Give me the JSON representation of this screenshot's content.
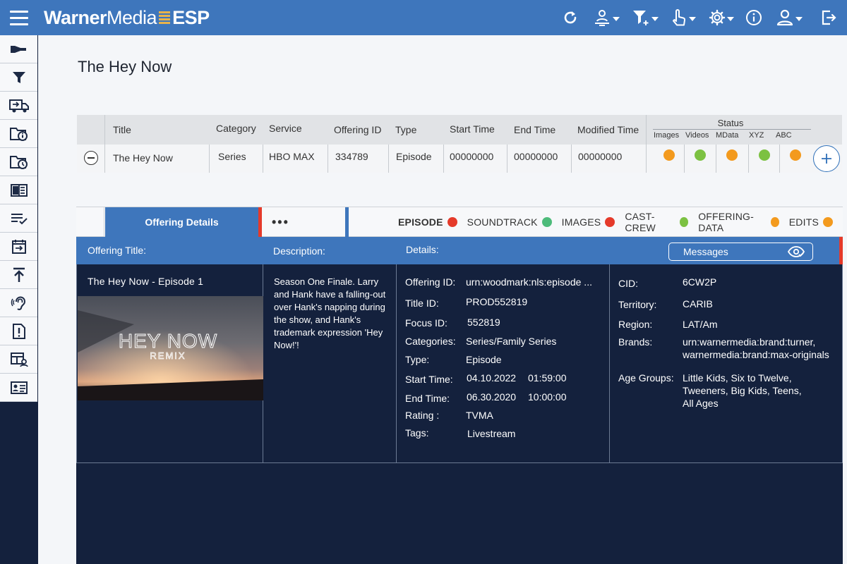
{
  "app": {
    "brand_part1": "Warner",
    "brand_part2": "Media",
    "brand_part3": "ESP"
  },
  "topbar_icons": [
    "refresh-icon",
    "user-location-icon",
    "filter-add-icon",
    "touch-icon",
    "gear-icon",
    "info-icon",
    "user-icon",
    "exit-icon"
  ],
  "sidebar_icons": [
    "hand-offer-icon",
    "filter-icon",
    "delivery-truck-icon",
    "folder-info-icon",
    "folder-clock-icon",
    "book-icon",
    "checklist-icon",
    "calendar-arrow-icon",
    "upload-icon",
    "ear-icon",
    "alert-doc-icon",
    "grid-user-icon",
    "id-card-icon"
  ],
  "page": {
    "title": "The Hey Now"
  },
  "table": {
    "headers": {
      "title": "Title",
      "category": "Category",
      "service": "Service",
      "offering_id": "Offering ID",
      "type": "Type",
      "start_time": "Start Time",
      "end_time": "End Time",
      "modified_time": "Modified Time",
      "status": "Status"
    },
    "status_columns": [
      "Images",
      "Videos",
      "MData",
      "XYZ",
      "ABC"
    ],
    "row": {
      "title": "The Hey Now",
      "category": "Series",
      "service": "HBO MAX",
      "offering_id": "334789",
      "type": "Episode",
      "start_time": "00000000",
      "end_time": "00000000",
      "modified_time": "00000000",
      "status_colors": [
        "#f39a1e",
        "#7cc142",
        "#f39a1e",
        "#7cc142",
        "#f39a1e"
      ]
    }
  },
  "tabs": {
    "active": "Offering Details",
    "more": "•••",
    "sections": [
      {
        "label": "EPISODE",
        "color": "#e53a2a",
        "active": true
      },
      {
        "label": "SOUNDTRACK",
        "color": "#4dbb7a"
      },
      {
        "label": "IMAGES",
        "color": "#e53a2a"
      },
      {
        "label": "CAST-CREW",
        "color": "#7cc142"
      },
      {
        "label": "OFFERING-DATA",
        "color": "#f39a1e"
      },
      {
        "label": "EDITS",
        "color": "#f39a1e"
      }
    ]
  },
  "details_header": {
    "offering_title": "Offering Title:",
    "description": "Description:",
    "details": "Details:",
    "messages": "Messages"
  },
  "offering": {
    "title": "The Hey Now - Episode 1",
    "thumb_title": "HEY NOW",
    "thumb_sub": "REMIX",
    "description": "Season One Finale. Larry and Hank have a falling-out over Hank's napping during the show, and Hank's trademark expression 'Hey Now!'!"
  },
  "details": {
    "offering_id_label": "Offering  ID:",
    "offering_id": "urn:woodmark:nls:episode ...",
    "title_id_label": "Title ID:",
    "title_id": "PROD552819",
    "focus_id_label": "Focus ID:",
    "focus_id": "552819",
    "categories_label": "Categories:",
    "categories": "Series/Family Series",
    "type_label": "Type:",
    "type": "Episode",
    "start_label": "Start Time:",
    "start_date": "04.10.2022",
    "start_time": "01:59:00",
    "end_label": "End Time:",
    "end_date": "06.30.2020",
    "end_time": "10:00:00",
    "rating_label": "Rating :",
    "rating": "TVMA",
    "tags_label": "Tags:",
    "tags": "Livestream"
  },
  "meta": {
    "cid_label": "CID:",
    "cid": "6CW2P",
    "territory_label": "Territory:",
    "territory": "CARIB",
    "region_label": "Region:",
    "region": "LAT/Am",
    "brands_label": "Brands:",
    "brands_line1": "urn:warnermedia:brand:turner,",
    "brands_line2": "warnermedia:brand:max-originals",
    "age_label": "Age Groups:",
    "age_line1": "Little Kids, Six to Twelve,",
    "age_line2": "Tweeners, Big Kids, Teens,",
    "age_line3": "All Ages"
  }
}
